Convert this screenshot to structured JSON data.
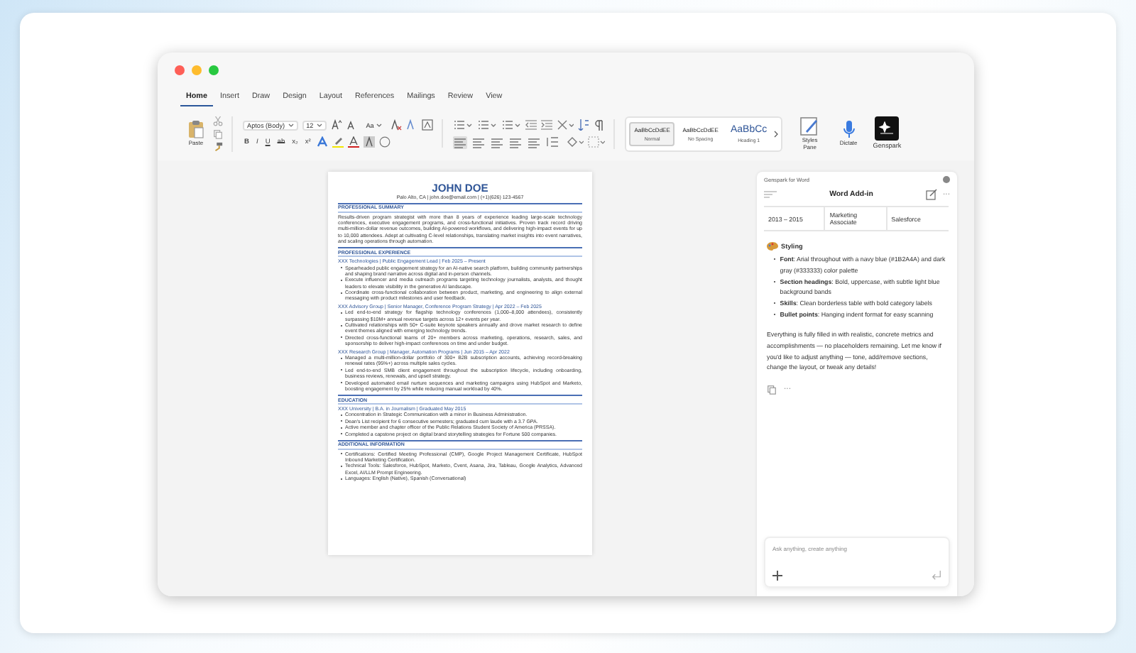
{
  "tabs": [
    {
      "label": "Home",
      "selected": true
    },
    {
      "label": "Insert",
      "selected": false
    },
    {
      "label": "Draw",
      "selected": false
    },
    {
      "label": "Design",
      "selected": false
    },
    {
      "label": "Layout",
      "selected": false
    },
    {
      "label": "References",
      "selected": false
    },
    {
      "label": "Mailings",
      "selected": false
    },
    {
      "label": "Review",
      "selected": false
    },
    {
      "label": "View",
      "selected": false
    }
  ],
  "ribbon": {
    "paste": "Paste",
    "format_buttons": [
      {
        "label": "B",
        "kind": "bold"
      },
      {
        "label": "I",
        "kind": "italic"
      },
      {
        "label": "U",
        "kind": "underline"
      },
      {
        "label": "ab",
        "kind": "strike"
      },
      {
        "label": "x₂",
        "kind": "plain"
      },
      {
        "label": "x²",
        "kind": "plain"
      }
    ],
    "font": "Aptos (Body)",
    "size": "12",
    "case_button": "Aa",
    "styles": [
      {
        "sample": "AaBbCcDdEE",
        "name": "Normal",
        "kind": "body",
        "selected": true
      },
      {
        "sample": "AaBbCcDdEE",
        "name": "No Spacing",
        "kind": "body",
        "selected": false
      },
      {
        "sample": "AaBbCc",
        "name": "Heading 1",
        "kind": "heading",
        "selected": false
      }
    ],
    "styles_pane": "Styles Pane",
    "dictate": "Dictate",
    "genspark": "Genspark"
  },
  "document": {
    "name": "JOHN DOE",
    "contact": "Palo Alto, CA  |  john.doe@email.com  |  (+1)(626) 123-4567",
    "sections": [
      {
        "heading": "PROFESSIONAL SUMMARY",
        "paragraph": "Results-driven program strategist with more than 8 years of experience leading large-scale technology conferences, executive engagement programs, and cross-functional initiatives. Proven track record driving multi-million-dollar revenue outcomes, building AI-powered workflows, and delivering high-impact events for up to 10,000 attendees. Adept at cultivating C-level relationships, translating market insights into event narratives, and scaling operations through automation."
      },
      {
        "heading": "PROFESSIONAL EXPERIENCE",
        "entries": [
          {
            "title": "XXX Technologies  |  Public Engagement Lead  |  Feb 2025 – Present",
            "bullets": [
              "Spearheaded public engagement strategy for an AI-native search platform, building community partnerships and shaping brand narrative across digital and in-person channels.",
              "Execute influencer and media outreach programs targeting technology journalists, analysts, and thought leaders to elevate visibility in the generative AI landscape.",
              "Coordinate cross-functional collaboration between product, marketing, and engineering to align external messaging with product milestones and user feedback."
            ]
          },
          {
            "title": "XXX Advisory Group  |  Senior Manager, Conference Program Strategy  |  Apr 2022 – Feb 2025",
            "bullets": [
              "Led end-to-end strategy for flagship technology conferences (1,000–8,000 attendees), consistently surpassing $10M+ annual revenue targets across 12+ events per year.",
              "Cultivated relationships with 50+ C-suite keynote speakers annually and drove market research to define event themes aligned with emerging technology trends.",
              "Directed cross-functional teams of 20+ members across marketing, operations, research, sales, and sponsorship to deliver high-impact conferences on time and under budget."
            ]
          },
          {
            "title": "XXX Research Group  |  Manager, Automation Programs  |  Jun 2015 – Apr 2022",
            "bullets": [
              "Managed a multi-million-dollar portfolio of 300+ B2B subscription accounts, achieving record-breaking renewal rates (95%+) across multiple sales cycles.",
              "Led end-to-end SMB client engagement throughout the subscription lifecycle, including onboarding, business reviews, renewals, and upsell strategy.",
              "Developed automated email nurture sequences and marketing campaigns using HubSpot and Marketo, boosting engagement by 25% while reducing manual workload by 40%."
            ]
          }
        ]
      },
      {
        "heading": "EDUCATION",
        "entries": [
          {
            "title": "XXX University  |  B.A. in Journalism  |  Graduated May 2015",
            "bullets": [
              "Concentration in Strategic Communication with a minor in Business Administration.",
              "Dean's List recipient for 6 consecutive semesters; graduated cum laude with a 3.7 GPA.",
              "Active member and chapter officer of the Public Relations Student Society of America (PRSSA).",
              "Completed a capstone project on digital brand storytelling strategies for Fortune 500 companies."
            ]
          }
        ]
      },
      {
        "heading": "ADDITIONAL INFORMATION",
        "entries": [
          {
            "bullets": [
              "Certifications: Certified Meeting Professional (CMP), Google Project Management Certificate, HubSpot Inbound Marketing Certification.",
              "Technical Tools: Salesforce, HubSpot, Marketo, Cvent, Asana, Jira, Tableau, Google Analytics, Advanced Excel, AI/LLM Prompt Engineering.",
              "Languages: English (Native), Spanish (Conversational)"
            ]
          }
        ]
      }
    ]
  },
  "panel": {
    "title": "Genspark for Word",
    "header": "Word Add-in",
    "more": "···",
    "table_row": [
      "2013 – 2015",
      "Marketing Associate",
      "Salesforce"
    ],
    "section": "Styling",
    "bullets": [
      "**Font**: Arial throughout with a navy blue (#1B2A4A) and dark gray (#333333) color palette",
      "**Section headings**: Bold, uppercase, with subtle light blue background bands",
      "**Skills**: Clean borderless table with bold category labels",
      "**Bullet points**: Hanging indent format for easy scanning"
    ],
    "message": "Everything is fully filled in with realistic, concrete metrics and accomplishments — no placeholders remaining. Let me know if you'd like to adjust anything — tone, add/remove sections, change the layout, or tweak any details!",
    "actions_more": "···",
    "input": {
      "placeholder": "Ask anything, create anything"
    }
  }
}
